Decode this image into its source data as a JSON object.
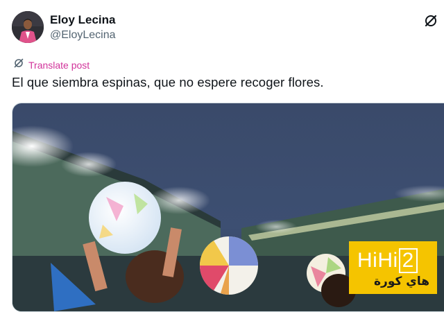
{
  "author": {
    "name": "Eloy Lecina",
    "handle": "@EloyLecina"
  },
  "actions": {
    "translate_label": "Translate post"
  },
  "post": {
    "text": "El que siembra espinas, que no espere recoger flores."
  },
  "watermark": {
    "main_prefix": "HiHi",
    "main_boxed": "2",
    "sub": "هاي كورة"
  },
  "colors": {
    "translate_accent": "#d1339a",
    "watermark_bg": "#f5c400",
    "handle_gray": "#536471"
  },
  "icons": {
    "grok": "grok-icon",
    "translate": "grok-translate-icon"
  }
}
